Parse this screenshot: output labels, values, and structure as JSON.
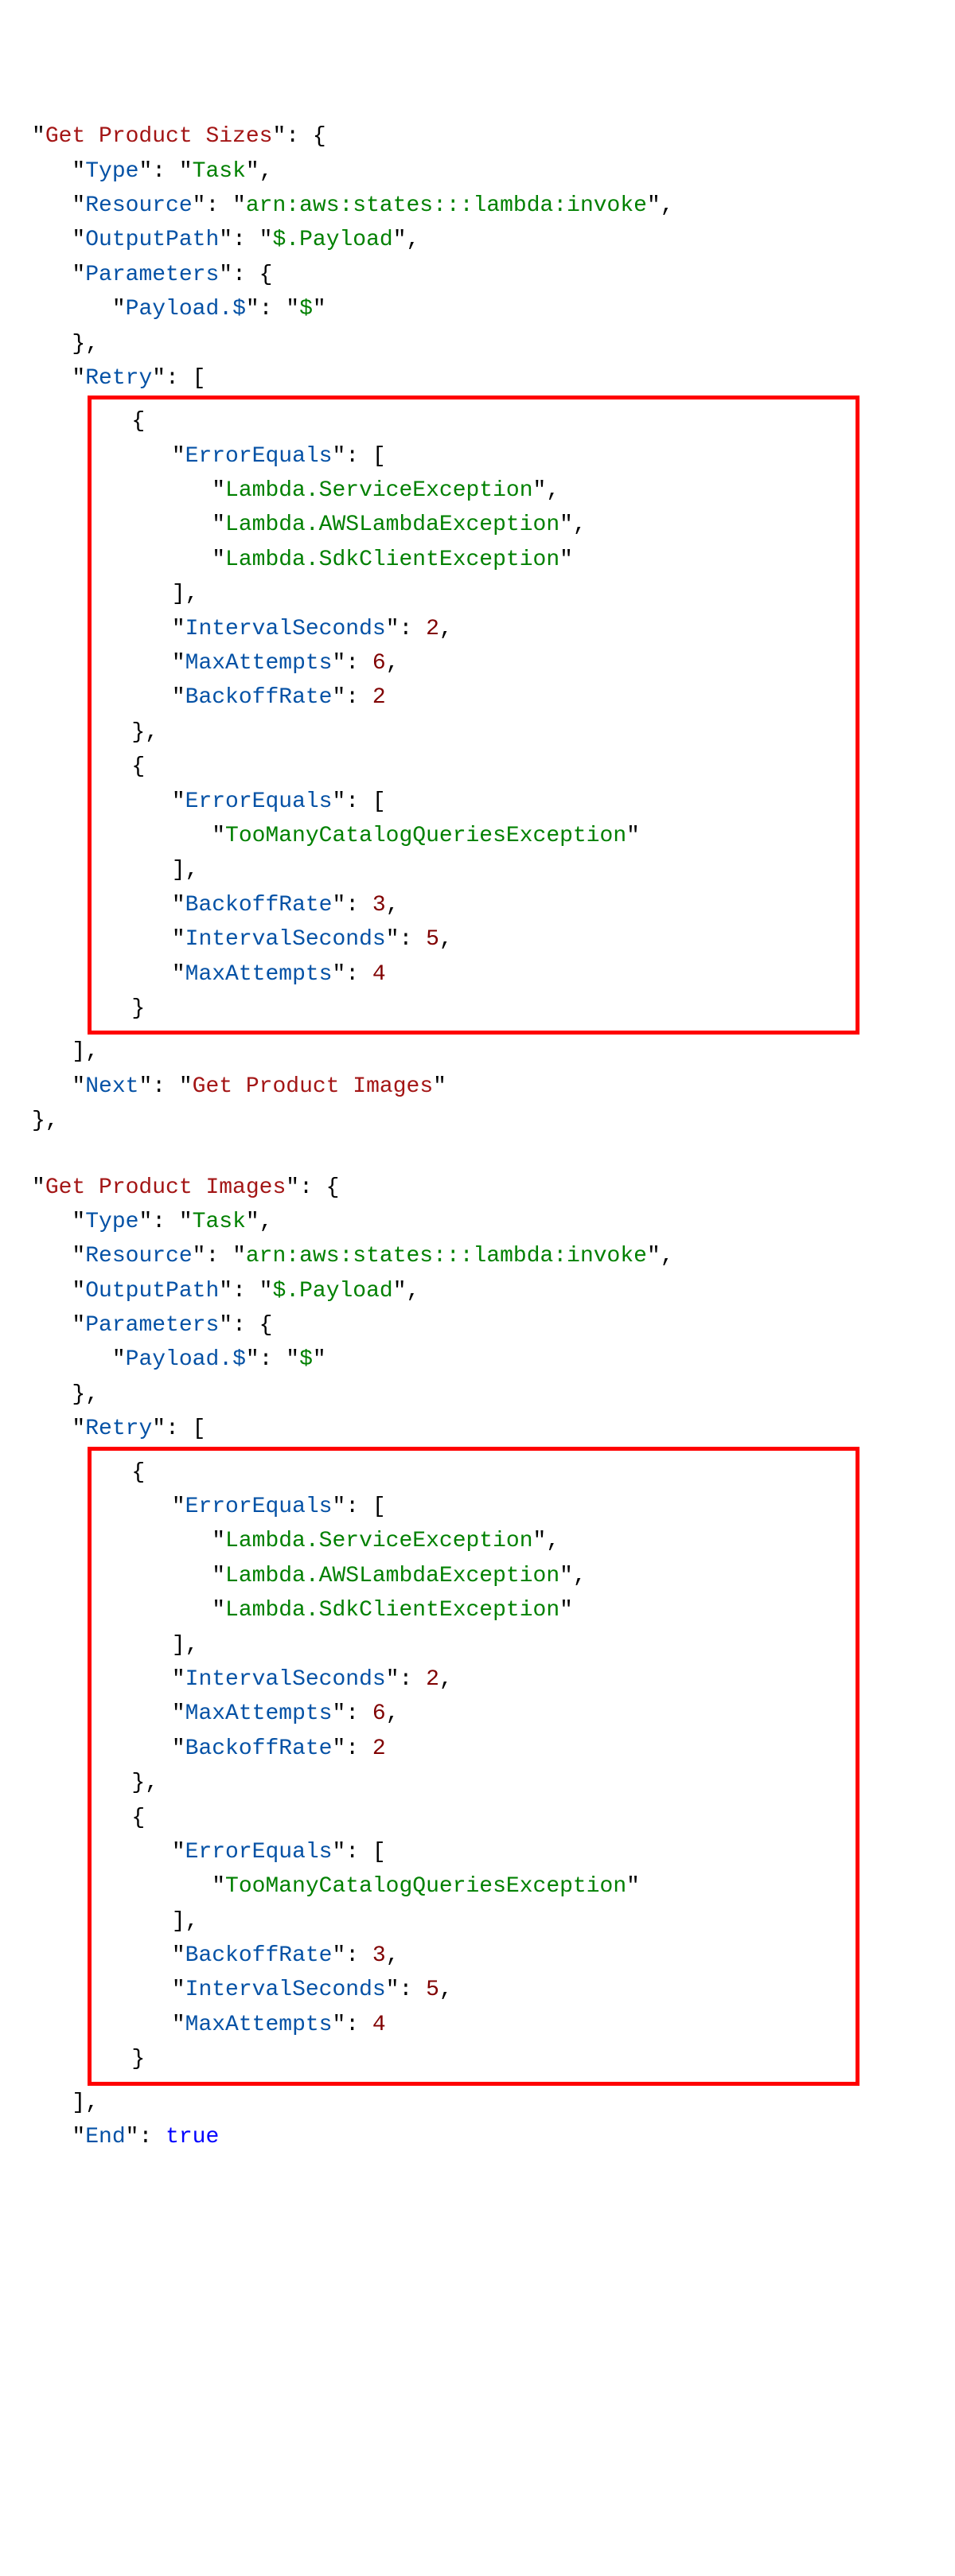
{
  "s1": {
    "name": "Get Product Sizes",
    "type": "Task",
    "resource": "arn:aws:states:::lambda:invoke",
    "outputPath": "$.Payload",
    "payloadKey": "Payload.$",
    "payloadVal": "$",
    "retry1": {
      "err1": "Lambda.ServiceException",
      "err2": "Lambda.AWSLambdaException",
      "err3": "Lambda.SdkClientException",
      "intervalSeconds": 2,
      "maxAttempts": 6,
      "backoffRate": 2
    },
    "retry2": {
      "err1": "TooManyCatalogQueriesException",
      "backoffRate": 3,
      "intervalSeconds": 5,
      "maxAttempts": 4
    },
    "nextKey": "Next",
    "nextVal": "Get Product Images"
  },
  "s2": {
    "name": "Get Product Images",
    "type": "Task",
    "resource": "arn:aws:states:::lambda:invoke",
    "outputPath": "$.Payload",
    "payloadKey": "Payload.$",
    "payloadVal": "$",
    "retry1": {
      "err1": "Lambda.ServiceException",
      "err2": "Lambda.AWSLambdaException",
      "err3": "Lambda.SdkClientException",
      "intervalSeconds": 2,
      "maxAttempts": 6,
      "backoffRate": 2
    },
    "retry2": {
      "err1": "TooManyCatalogQueriesException",
      "backoffRate": 3,
      "intervalSeconds": 5,
      "maxAttempts": 4
    },
    "endKey": "End",
    "endVal": "true"
  },
  "lbl": {
    "Type": "Type",
    "Resource": "Resource",
    "OutputPath": "OutputPath",
    "Parameters": "Parameters",
    "Retry": "Retry",
    "ErrorEquals": "ErrorEquals",
    "IntervalSeconds": "IntervalSeconds",
    "MaxAttempts": "MaxAttempts",
    "BackoffRate": "BackoffRate"
  }
}
